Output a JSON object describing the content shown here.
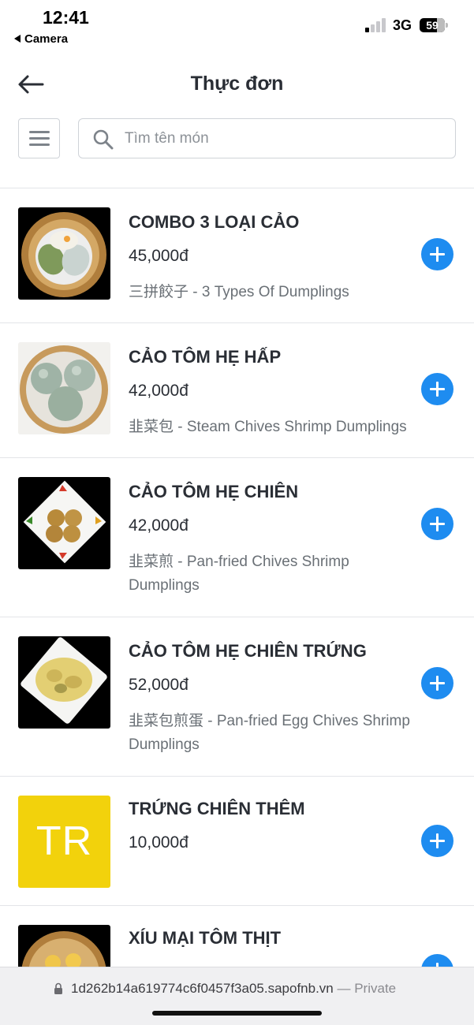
{
  "status_bar": {
    "time": "12:41",
    "back_app": "Camera",
    "network": "3G",
    "battery": "59"
  },
  "header": {
    "title": "Thực đơn",
    "back_icon": "back-arrow-icon",
    "menu_icon": "hamburger-icon"
  },
  "search": {
    "placeholder": "Tìm tên món",
    "value": "",
    "icon": "search-icon"
  },
  "menu_items": [
    {
      "name": "COMBO 3 LOẠI CẢO",
      "price": "45,000đ",
      "description": "三拼餃子 - 3 Types Of Dumplings",
      "image": "dumpling-steamer-photo"
    },
    {
      "name": "CẢO TÔM HẸ HẤP",
      "price": "42,000đ",
      "description": "韭菜包 - Steam Chives Shrimp Dumplings",
      "image": "chive-dumplings-photo"
    },
    {
      "name": "CẢO TÔM HẸ CHIÊN",
      "price": "42,000đ",
      "description": "韭菜煎 - Pan-fried Chives Shrimp Dumplings",
      "image": "fried-dumplings-plate-photo"
    },
    {
      "name": "CẢO TÔM HẸ CHIÊN TRỨNG",
      "price": "52,000đ",
      "description": "韭菜包煎蛋 - Pan-fried Egg Chives Shrimp Dumplings",
      "image": "egg-dumplings-plate-photo"
    },
    {
      "name": "TRỨNG CHIÊN THÊM",
      "price": "10,000đ",
      "description": "",
      "image_text": "TR"
    },
    {
      "name": "XÍU MẠI TÔM THỊT",
      "price": "",
      "description": "",
      "image": "siu-mai-steamer-photo"
    }
  ],
  "url_bar": {
    "url": "1d262b14a619774c6f0457f3a05.sapofnb.vn",
    "mode": "— Private"
  },
  "colors": {
    "accent": "#1e8cf0",
    "placeholder_yellow": "#f2d20c",
    "text_dark": "#2a2e35",
    "text_muted": "#6a7076"
  }
}
